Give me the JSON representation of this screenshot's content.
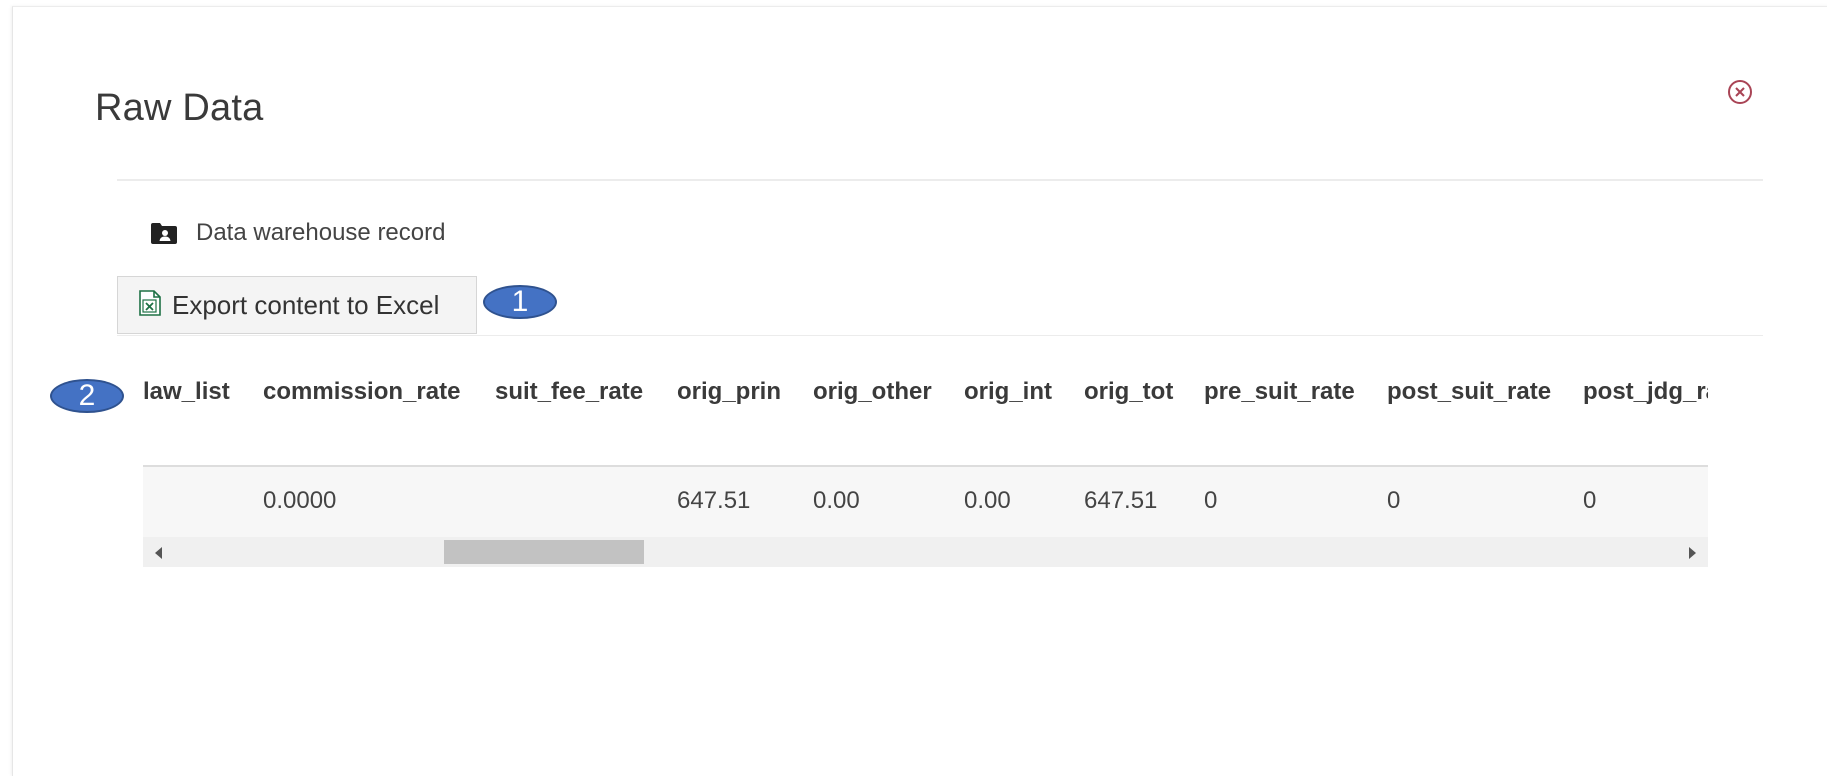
{
  "dialog": {
    "title": "Raw Data",
    "close_icon": "close-circle-icon"
  },
  "record": {
    "icon": "folder-account-icon",
    "label": "Data warehouse record"
  },
  "export": {
    "icon": "excel-icon",
    "label": "Export content to Excel"
  },
  "callouts": [
    "1",
    "2"
  ],
  "table": {
    "columns": [
      "law_list",
      "commission_rate",
      "suit_fee_rate",
      "orig_prin",
      "orig_other",
      "orig_int",
      "orig_tot",
      "pre_suit_rate",
      "post_suit_rate",
      "post_jdg_ra"
    ],
    "rows": [
      [
        "",
        "0.0000",
        "",
        "647.51",
        "0.00",
        "0.00",
        "647.51",
        "0",
        "0",
        "0"
      ]
    ]
  },
  "colors": {
    "callout_fill": "#4472c4",
    "close_icon": "#a94455",
    "excel_icon": "#1e7145"
  }
}
